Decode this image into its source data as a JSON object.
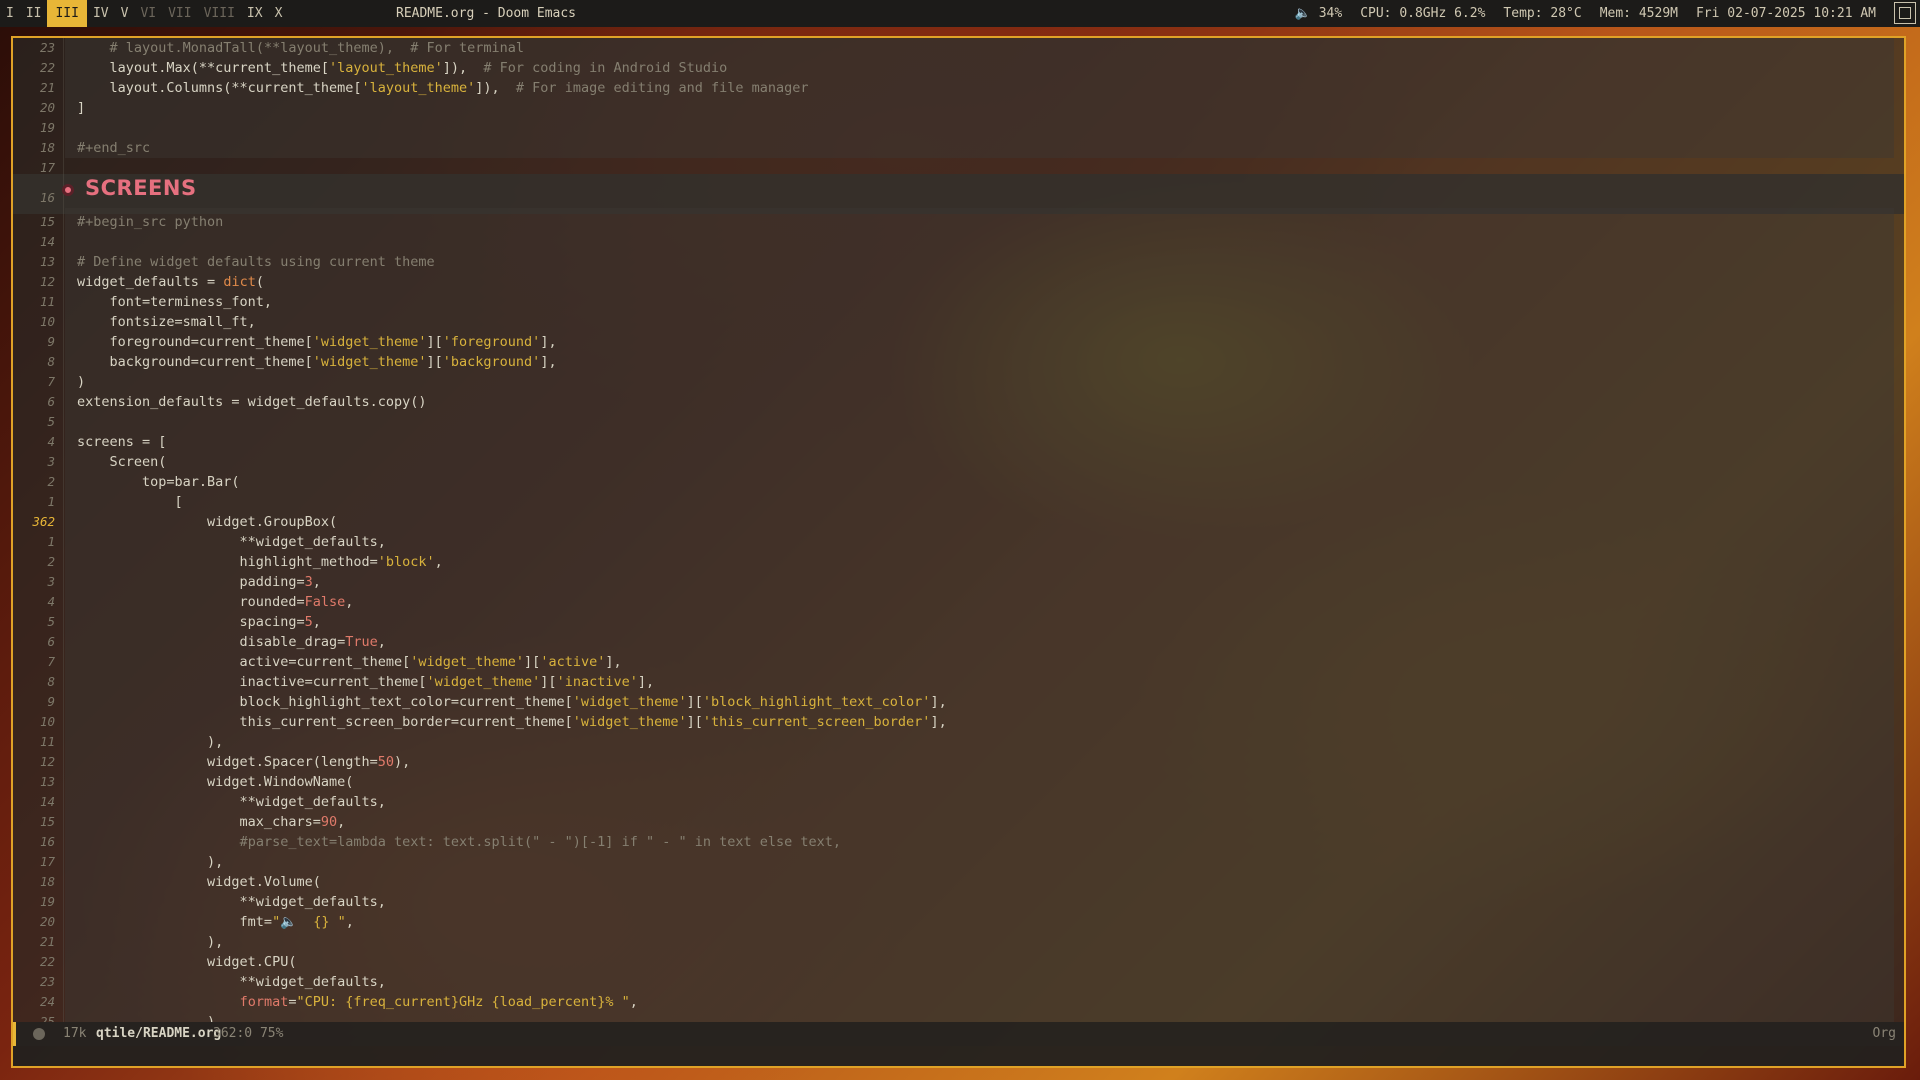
{
  "topbar": {
    "workspaces": [
      {
        "label": "I",
        "state": "normal"
      },
      {
        "label": "II",
        "state": "normal"
      },
      {
        "label": "III",
        "state": "active"
      },
      {
        "label": "IV",
        "state": "normal"
      },
      {
        "label": "V",
        "state": "normal"
      },
      {
        "label": "VI",
        "state": "dim"
      },
      {
        "label": "VII",
        "state": "dim"
      },
      {
        "label": "VIII",
        "state": "dim"
      },
      {
        "label": "IX",
        "state": "normal"
      },
      {
        "label": "X",
        "state": "normal"
      }
    ],
    "window_title": "README.org - Doom Emacs",
    "volume": "🔈 34%",
    "cpu": "CPU: 0.8GHz 6.2%",
    "temp": "Temp: 28°C",
    "mem": "Mem: 4529M",
    "clock": "Fri 02-07-2025 10:21 AM"
  },
  "editor": {
    "heading": "SCREENS",
    "lines": [
      {
        "n": "23",
        "parts": [
          [
            "    ",
            ""
          ],
          [
            "# layout.MonadTall(**layout_theme),  # For terminal",
            "c-comment"
          ]
        ]
      },
      {
        "n": "22",
        "parts": [
          [
            "    layout.Max(**current_theme[",
            ""
          ],
          [
            "'layout_theme'",
            "c-str"
          ],
          [
            "]),  ",
            ""
          ],
          [
            "# For coding in Android Studio",
            "c-comment"
          ]
        ]
      },
      {
        "n": "21",
        "parts": [
          [
            "    layout.Columns(**current_theme[",
            ""
          ],
          [
            "'layout_theme'",
            "c-str"
          ],
          [
            "]),  ",
            ""
          ],
          [
            "# For image editing and file manager",
            "c-comment"
          ]
        ]
      },
      {
        "n": "20",
        "parts": [
          [
            "]",
            ""
          ]
        ]
      },
      {
        "n": "19",
        "parts": []
      },
      {
        "n": "18",
        "parts": [
          [
            "#+end_src",
            "c-meta"
          ]
        ]
      },
      {
        "n": "17",
        "parts": []
      },
      {
        "n": "16",
        "parts": [],
        "heading": true
      },
      {
        "n": "15",
        "parts": [
          [
            "#+begin_src python",
            "c-meta"
          ]
        ]
      },
      {
        "n": "14",
        "parts": []
      },
      {
        "n": "13",
        "parts": [
          [
            "# Define widget defaults using current theme",
            "c-comment"
          ]
        ]
      },
      {
        "n": "12",
        "parts": [
          [
            "widget_defaults = ",
            ""
          ],
          [
            "dict",
            "c-fn"
          ],
          [
            "(",
            ""
          ]
        ]
      },
      {
        "n": "11",
        "parts": [
          [
            "    font=terminess_font,",
            ""
          ]
        ]
      },
      {
        "n": "10",
        "parts": [
          [
            "    fontsize=small_ft,",
            ""
          ]
        ]
      },
      {
        "n": "9",
        "parts": [
          [
            "    foreground=current_theme[",
            ""
          ],
          [
            "'widget_theme'",
            "c-str"
          ],
          [
            "][",
            ""
          ],
          [
            "'foreground'",
            "c-str"
          ],
          [
            "],",
            ""
          ]
        ]
      },
      {
        "n": "8",
        "parts": [
          [
            "    background=current_theme[",
            ""
          ],
          [
            "'widget_theme'",
            "c-str"
          ],
          [
            "][",
            ""
          ],
          [
            "'background'",
            "c-str"
          ],
          [
            "],",
            ""
          ]
        ]
      },
      {
        "n": "7",
        "parts": [
          [
            ")",
            ""
          ]
        ]
      },
      {
        "n": "6",
        "parts": [
          [
            "extension_defaults = widget_defaults.copy()",
            ""
          ]
        ]
      },
      {
        "n": "5",
        "parts": []
      },
      {
        "n": "4",
        "parts": [
          [
            "screens = [",
            ""
          ]
        ]
      },
      {
        "n": "3",
        "parts": [
          [
            "    Screen(",
            ""
          ]
        ]
      },
      {
        "n": "2",
        "parts": [
          [
            "        top=bar.Bar(",
            ""
          ]
        ]
      },
      {
        "n": "1",
        "parts": [
          [
            "            [",
            ""
          ]
        ]
      },
      {
        "n": "362",
        "cur": true,
        "parts": [
          [
            "                widget.GroupBox(",
            ""
          ]
        ]
      },
      {
        "n": "1",
        "parts": [
          [
            "                    **widget_defaults,",
            ""
          ]
        ]
      },
      {
        "n": "2",
        "parts": [
          [
            "                    highlight_method=",
            ""
          ],
          [
            "'block'",
            "c-str"
          ],
          [
            ",",
            ""
          ]
        ]
      },
      {
        "n": "3",
        "parts": [
          [
            "                    padding=",
            ""
          ],
          [
            "3",
            "c-num"
          ],
          [
            ",",
            ""
          ]
        ]
      },
      {
        "n": "4",
        "parts": [
          [
            "                    rounded=",
            ""
          ],
          [
            "False",
            "c-kw"
          ],
          [
            ",",
            ""
          ]
        ]
      },
      {
        "n": "5",
        "parts": [
          [
            "                    spacing=",
            ""
          ],
          [
            "5",
            "c-num"
          ],
          [
            ",",
            ""
          ]
        ]
      },
      {
        "n": "6",
        "parts": [
          [
            "                    disable_drag=",
            ""
          ],
          [
            "True",
            "c-kw"
          ],
          [
            ",",
            ""
          ]
        ]
      },
      {
        "n": "7",
        "parts": [
          [
            "                    active=current_theme[",
            ""
          ],
          [
            "'widget_theme'",
            "c-str"
          ],
          [
            "][",
            ""
          ],
          [
            "'active'",
            "c-str"
          ],
          [
            "],",
            ""
          ]
        ]
      },
      {
        "n": "8",
        "parts": [
          [
            "                    inactive=current_theme[",
            ""
          ],
          [
            "'widget_theme'",
            "c-str"
          ],
          [
            "][",
            ""
          ],
          [
            "'inactive'",
            "c-str"
          ],
          [
            "],",
            ""
          ]
        ]
      },
      {
        "n": "9",
        "parts": [
          [
            "                    block_highlight_text_color=current_theme[",
            ""
          ],
          [
            "'widget_theme'",
            "c-str"
          ],
          [
            "][",
            ""
          ],
          [
            "'block_highlight_text_color'",
            "c-str"
          ],
          [
            "],",
            ""
          ]
        ]
      },
      {
        "n": "10",
        "parts": [
          [
            "                    this_current_screen_border=current_theme[",
            ""
          ],
          [
            "'widget_theme'",
            "c-str"
          ],
          [
            "][",
            ""
          ],
          [
            "'this_current_screen_border'",
            "c-str"
          ],
          [
            "],",
            ""
          ]
        ]
      },
      {
        "n": "11",
        "parts": [
          [
            "                ),",
            ""
          ]
        ]
      },
      {
        "n": "12",
        "parts": [
          [
            "                widget.Spacer(length=",
            ""
          ],
          [
            "50",
            "c-num"
          ],
          [
            "),",
            ""
          ]
        ]
      },
      {
        "n": "13",
        "parts": [
          [
            "                widget.WindowName(",
            ""
          ]
        ]
      },
      {
        "n": "14",
        "parts": [
          [
            "                    **widget_defaults,",
            ""
          ]
        ]
      },
      {
        "n": "15",
        "parts": [
          [
            "                    max_chars=",
            ""
          ],
          [
            "90",
            "c-num"
          ],
          [
            ",",
            ""
          ]
        ]
      },
      {
        "n": "16",
        "parts": [
          [
            "                    ",
            ""
          ],
          [
            "#parse_text=lambda text: text.split(\" - \")[-1] if \" - \" in text else text,",
            "c-comment"
          ]
        ]
      },
      {
        "n": "17",
        "parts": [
          [
            "                ),",
            ""
          ]
        ]
      },
      {
        "n": "18",
        "parts": [
          [
            "                widget.Volume(",
            ""
          ]
        ]
      },
      {
        "n": "19",
        "parts": [
          [
            "                    **widget_defaults,",
            ""
          ]
        ]
      },
      {
        "n": "20",
        "parts": [
          [
            "                    fmt=",
            ""
          ],
          [
            "\"🔈  {} \"",
            "c-str"
          ],
          [
            ",",
            ""
          ]
        ]
      },
      {
        "n": "21",
        "parts": [
          [
            "                ),",
            ""
          ]
        ]
      },
      {
        "n": "22",
        "parts": [
          [
            "                widget.CPU(",
            ""
          ]
        ]
      },
      {
        "n": "23",
        "parts": [
          [
            "                    **widget_defaults,",
            ""
          ]
        ]
      },
      {
        "n": "24",
        "parts": [
          [
            "                    ",
            ""
          ],
          [
            "format",
            "c-kw"
          ],
          [
            "=",
            ""
          ],
          [
            "\"CPU: {freq_current}GHz {load_percent}% \"",
            "c-str"
          ],
          [
            ",",
            ""
          ]
        ]
      },
      {
        "n": "25",
        "parts": [
          [
            "                ),",
            ""
          ]
        ]
      }
    ]
  },
  "modeline": {
    "size": "17k",
    "file": "qtile/README.org",
    "position": "362:0 75%",
    "mode": "Org"
  }
}
